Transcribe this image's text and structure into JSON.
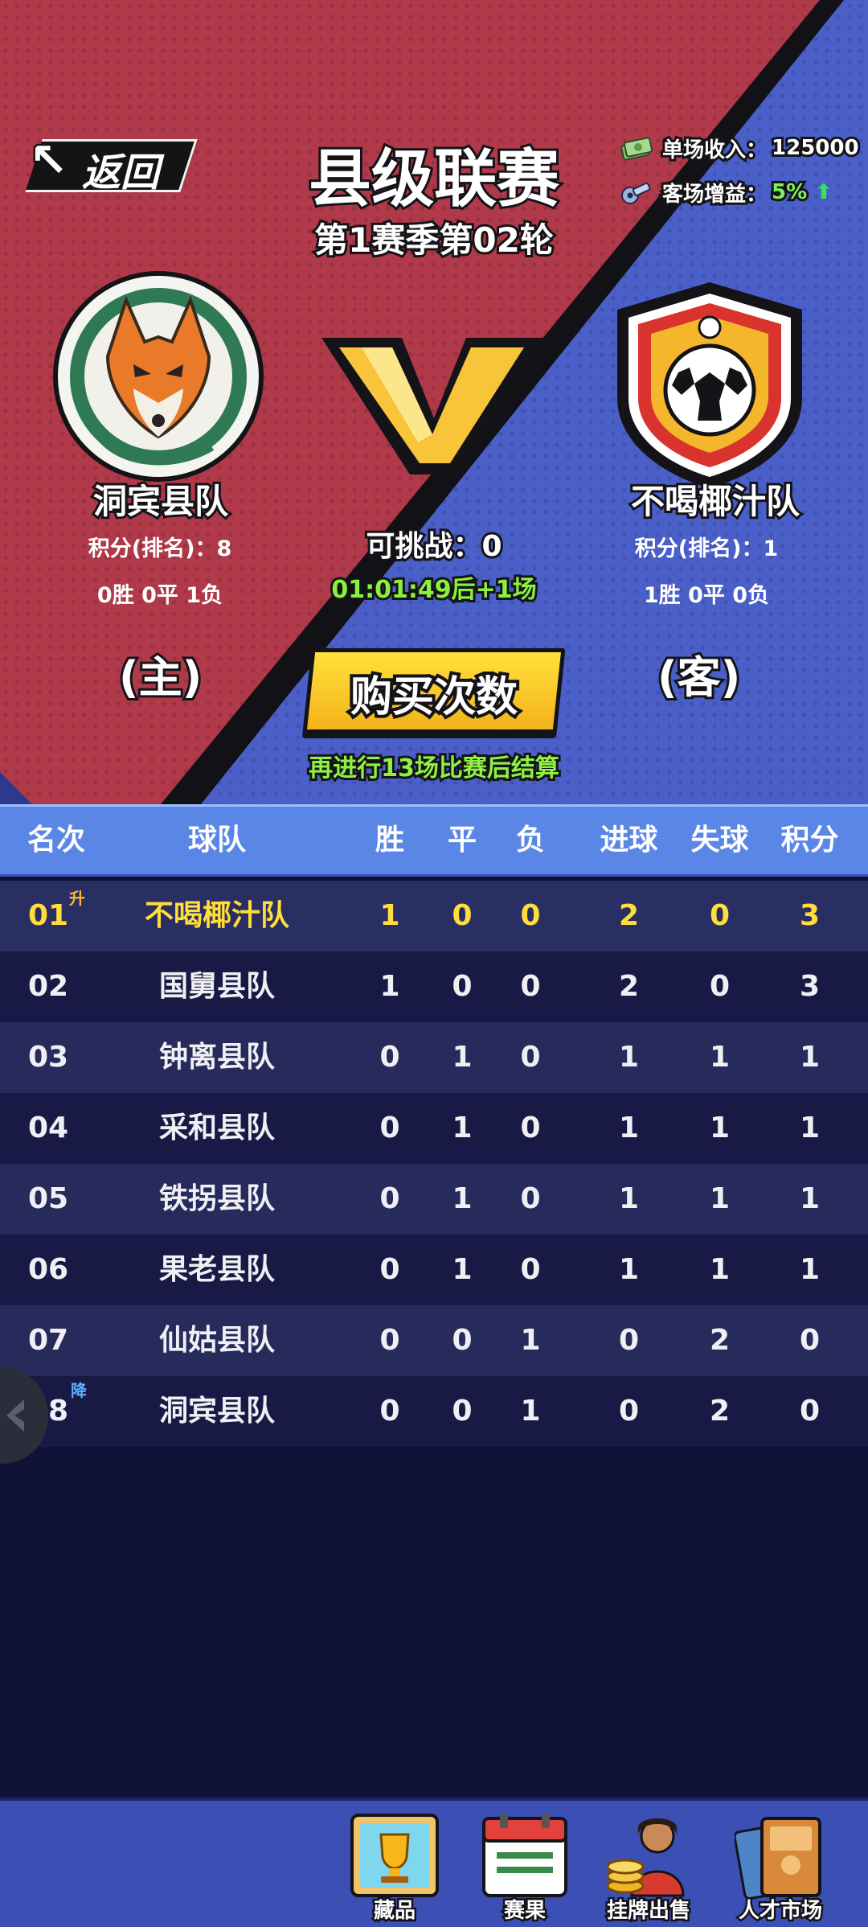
{
  "header": {
    "back_label": "返回",
    "league_title": "县级联赛",
    "season_round": "第1赛季第02轮",
    "income_label": "单场收入：",
    "income_value": "125000",
    "away_bonus_label": "客场增益：",
    "away_bonus_value": "5%",
    "vs_text": "VS"
  },
  "home": {
    "name": "洞宾县队",
    "points_rank": "积分(排名)：8",
    "record": "0胜 0平 1负",
    "tag": "(主)"
  },
  "away": {
    "name": "不喝椰汁队",
    "points_rank": "积分(排名)：1",
    "record": "1胜 0平 0负",
    "tag": "(客)"
  },
  "match": {
    "challenge": "可挑战：0",
    "timer": "01:01:49后+1场",
    "buy_label": "购买次数",
    "settle_note": "再进行13场比赛后结算"
  },
  "table": {
    "headers": [
      "名次",
      "球队",
      "胜",
      "平",
      "负",
      "进球",
      "失球",
      "积分"
    ],
    "rows": [
      {
        "rank": "01",
        "team": "不喝椰汁队",
        "w": "1",
        "d": "0",
        "l": "0",
        "gf": "2",
        "ga": "0",
        "pts": "3",
        "mark": "升"
      },
      {
        "rank": "02",
        "team": "国舅县队",
        "w": "1",
        "d": "0",
        "l": "0",
        "gf": "2",
        "ga": "0",
        "pts": "3"
      },
      {
        "rank": "03",
        "team": "钟离县队",
        "w": "0",
        "d": "1",
        "l": "0",
        "gf": "1",
        "ga": "1",
        "pts": "1"
      },
      {
        "rank": "04",
        "team": "采和县队",
        "w": "0",
        "d": "1",
        "l": "0",
        "gf": "1",
        "ga": "1",
        "pts": "1"
      },
      {
        "rank": "05",
        "team": "铁拐县队",
        "w": "0",
        "d": "1",
        "l": "0",
        "gf": "1",
        "ga": "1",
        "pts": "1"
      },
      {
        "rank": "06",
        "team": "果老县队",
        "w": "0",
        "d": "1",
        "l": "0",
        "gf": "1",
        "ga": "1",
        "pts": "1"
      },
      {
        "rank": "07",
        "team": "仙姑县队",
        "w": "0",
        "d": "0",
        "l": "1",
        "gf": "0",
        "ga": "2",
        "pts": "0"
      },
      {
        "rank": "08",
        "team": "洞宾县队",
        "w": "0",
        "d": "0",
        "l": "1",
        "gf": "0",
        "ga": "2",
        "pts": "0",
        "mark": "降"
      }
    ]
  },
  "nav": {
    "collection": "藏品",
    "results": "赛果",
    "listing": "挂牌出售",
    "talent": "人才市场"
  },
  "colors": {
    "home_side": "#b0394a",
    "away_side": "#4a5fc8",
    "table_header": "#5a86e6",
    "highlight": "#ffdd3a",
    "timer_green": "#8af23c"
  },
  "icons": {
    "back": "back-arrow-icon",
    "income": "cash-icon",
    "away_bonus": "whistle-icon",
    "bonus_trend": "up-arrow-icon",
    "home_logo": "fox-crest-icon",
    "away_logo": "football-shield-icon",
    "collection": "trophy-icon",
    "results": "calendar-icon",
    "listing": "player-coins-icon",
    "talent": "book-icon"
  }
}
